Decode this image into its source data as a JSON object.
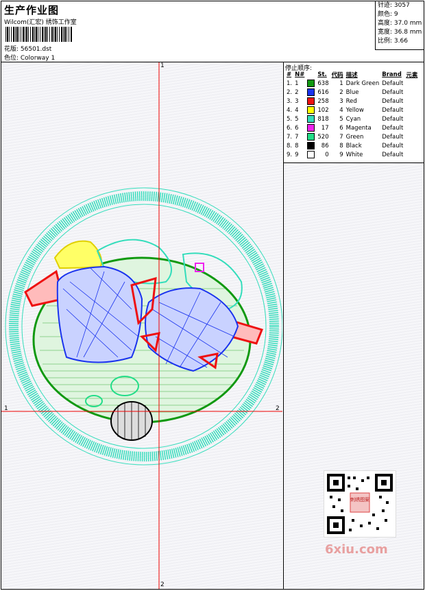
{
  "header": {
    "title": "生产作业图",
    "company": "Wilcom(汇宏) 绣饰工作室",
    "design_label": "花版: 56501.dst",
    "colorway_label": "色位: Colorway 1"
  },
  "stats": {
    "stitches": "针迹: 3057",
    "colors": "颜色: 9",
    "height": "高度: 37.0 mm",
    "width": "宽度: 36.8 mm",
    "scale": "比例: 3.66"
  },
  "stop_sequence": {
    "title": "停止顺序:",
    "columns": [
      "#",
      "N#",
      "St.",
      "代码",
      "描述",
      "Brand",
      "元素"
    ],
    "rows": [
      {
        "idx": "1.",
        "n": "1",
        "color": "#119911",
        "st": "638",
        "code": "1",
        "desc": "Dark Green",
        "brand": "Default"
      },
      {
        "idx": "2.",
        "n": "2",
        "color": "#1a33ee",
        "st": "616",
        "code": "2",
        "desc": "Blue",
        "brand": "Default"
      },
      {
        "idx": "3.",
        "n": "3",
        "color": "#ee1111",
        "st": "258",
        "code": "3",
        "desc": "Red",
        "brand": "Default"
      },
      {
        "idx": "4.",
        "n": "4",
        "color": "#ffff00",
        "st": "102",
        "code": "4",
        "desc": "Yellow",
        "brand": "Default"
      },
      {
        "idx": "5.",
        "n": "5",
        "color": "#33ddbb",
        "st": "818",
        "code": "5",
        "desc": "Cyan",
        "brand": "Default"
      },
      {
        "idx": "6.",
        "n": "6",
        "color": "#ee22ee",
        "st": "17",
        "code": "6",
        "desc": "Magenta",
        "brand": "Default"
      },
      {
        "idx": "7.",
        "n": "7",
        "color": "#22dd88",
        "st": "520",
        "code": "7",
        "desc": "Green",
        "brand": "Default"
      },
      {
        "idx": "8.",
        "n": "8",
        "color": "#000000",
        "st": "86",
        "code": "8",
        "desc": "Black",
        "brand": "Default"
      },
      {
        "idx": "9.",
        "n": "9",
        "color": "#ffffff",
        "st": "0",
        "code": "9",
        "desc": "White",
        "brand": "Default"
      }
    ]
  },
  "axes": {
    "top": "1",
    "bottom": "2",
    "left": "1",
    "right": "2"
  },
  "watermark": "6xiu.com",
  "qr_badge": "刺绣图案",
  "colors": {
    "axis": "#ee0000",
    "ring": "#33ddbb",
    "fill_green": "#119911",
    "blue": "#1a33ee"
  }
}
